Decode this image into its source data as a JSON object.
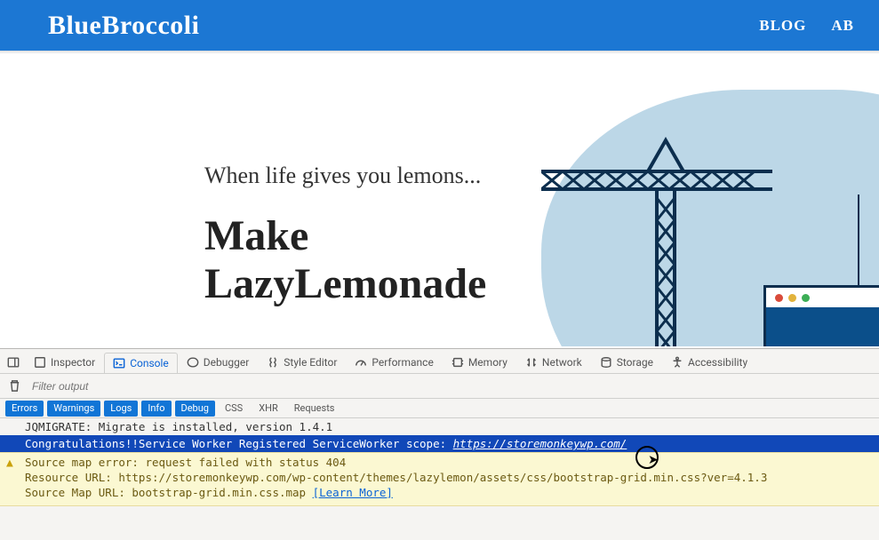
{
  "site": {
    "logo": "BlueBroccoli",
    "nav": {
      "blog": "BLOG",
      "about": "AB"
    },
    "hero_tag": "When life gives you lemons...",
    "hero_head": "Make\nLazyLemonade"
  },
  "devtools": {
    "tabs": {
      "inspector": "Inspector",
      "console": "Console",
      "debugger": "Debugger",
      "styleeditor": "Style Editor",
      "performance": "Performance",
      "memory": "Memory",
      "network": "Network",
      "storage": "Storage",
      "accessibility": "Accessibility"
    },
    "filter_placeholder": "Filter output",
    "chips": {
      "errors": "Errors",
      "warnings": "Warnings",
      "logs": "Logs",
      "info": "Info",
      "debug": "Debug",
      "css": "CSS",
      "xhr": "XHR",
      "requests": "Requests"
    },
    "log": {
      "migrate": "JQMIGRATE: Migrate is installed, version 1.4.1",
      "sw_prefix": "Congratulations!!Service Worker Registered ServiceWorker scope:  ",
      "sw_url": "https://storemonkeywp.com/",
      "warn_line1": "Source map error: request failed with status 404",
      "warn_line2": "Resource URL: https://storemonkeywp.com/wp-content/themes/lazylemon/assets/css/bootstrap-grid.min.css?ver=4.1.3",
      "warn_line3_a": "Source Map URL: bootstrap-grid.min.css.map ",
      "warn_learn": "[Learn More]"
    }
  }
}
